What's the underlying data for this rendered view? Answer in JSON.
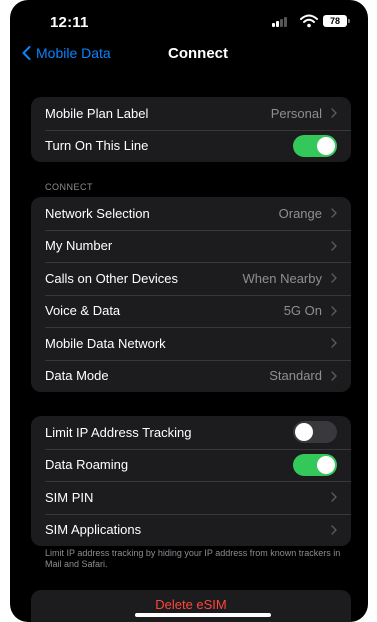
{
  "status_bar": {
    "time": "12:11",
    "battery": "78"
  },
  "nav": {
    "back_label": "Mobile Data",
    "title": "Connect"
  },
  "plan_group": [
    {
      "label": "Mobile Plan Label",
      "value": "Personal",
      "chevron": true
    },
    {
      "label": "Turn On This Line",
      "toggle": true
    }
  ],
  "connect_section": {
    "header": "CONNECT",
    "rows": [
      {
        "label": "Network Selection",
        "value": "Orange"
      },
      {
        "label": "My Number",
        "value": ""
      },
      {
        "label": "Calls on Other Devices",
        "value": "When Nearby"
      },
      {
        "label": "Voice & Data",
        "value": "5G On"
      },
      {
        "label": "Mobile Data Network",
        "value": ""
      },
      {
        "label": "Data Mode",
        "value": "Standard"
      }
    ]
  },
  "privacy_group": [
    {
      "label": "Limit IP Address Tracking",
      "toggle": false
    },
    {
      "label": "Data Roaming",
      "toggle": true
    },
    {
      "label": "SIM PIN"
    },
    {
      "label": "SIM Applications"
    }
  ],
  "footer_note": "Limit IP address tracking by hiding your IP address from known trackers in Mail and Safari.",
  "delete_label": "Delete eSIM",
  "colors": {
    "accent": "#0a84ff",
    "toggle_on": "#34c759",
    "destructive": "#ff453a",
    "cell_bg": "#1c1c1e"
  }
}
